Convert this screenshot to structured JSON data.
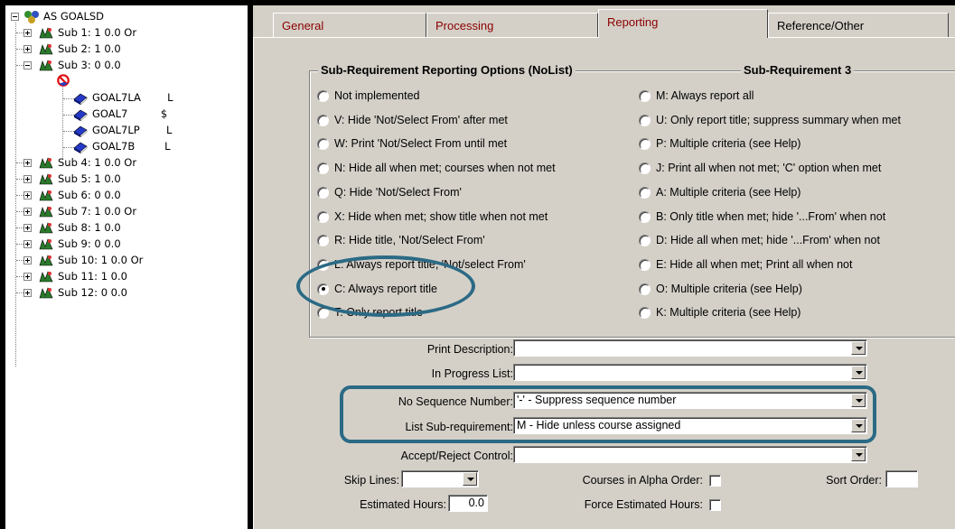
{
  "tree": {
    "root": {
      "label": "AS GOALSD"
    },
    "subs_top": [
      {
        "label": "Sub 1:  1     0.0  Or"
      },
      {
        "label": "Sub 2:  1     0.0"
      },
      {
        "label": "Sub 3:  0     0.0"
      }
    ],
    "sub3_children": [
      {
        "label": "",
        "icon": "no-sign-icon"
      },
      {
        "label": "GOAL7LA        L"
      },
      {
        "label": "GOAL7          $"
      },
      {
        "label": "GOAL7LP        L"
      },
      {
        "label": "GOAL7B         L"
      }
    ],
    "subs_bottom": [
      {
        "label": "Sub 4:  1     0.0  Or"
      },
      {
        "label": "Sub 5:  1     0.0"
      },
      {
        "label": "Sub 6:  0     0.0"
      },
      {
        "label": "Sub 7:  1     0.0  Or"
      },
      {
        "label": "Sub 8:  1     0.0"
      },
      {
        "label": "Sub 9:  0     0.0"
      },
      {
        "label": "Sub 10:  1     0.0  Or"
      },
      {
        "label": "Sub 11:  1     0.0"
      },
      {
        "label": "Sub 12:  0     0.0"
      }
    ]
  },
  "tabs": [
    {
      "label": "General",
      "active": false
    },
    {
      "label": "Processing",
      "active": false
    },
    {
      "label": "Reporting",
      "active": true
    },
    {
      "label": "Reference/Other",
      "active": false
    }
  ],
  "reporting": {
    "group_title": "Sub-Requirement Reporting Options (NoList)",
    "sub_title": "Sub-Requirement 3",
    "left_options": [
      {
        "label": "Not implemented",
        "checked": false
      },
      {
        "label": "V: Hide 'Not/Select From' after met",
        "checked": false
      },
      {
        "label": "W: Print 'Not/Select From until met",
        "checked": false
      },
      {
        "label": "N: Hide all when met; courses when not met",
        "checked": false
      },
      {
        "label": "Q: Hide 'Not/Select From'",
        "checked": false
      },
      {
        "label": "X: Hide when met; show title when not met",
        "checked": false
      },
      {
        "label": "R: Hide title, 'Not/Select From'",
        "checked": false
      },
      {
        "label": "L: Always report title, 'Not/select From'",
        "checked": false
      },
      {
        "label": "C: Always report title",
        "checked": true
      },
      {
        "label": "T: Only report title",
        "checked": false
      }
    ],
    "right_options": [
      {
        "label": "M: Always report all",
        "checked": false
      },
      {
        "label": "U: Only report title; suppress summary when met",
        "checked": false
      },
      {
        "label": "P: Multiple criteria (see Help)",
        "checked": false
      },
      {
        "label": "J: Print all when not met; 'C' option when met",
        "checked": false
      },
      {
        "label": "A: Multiple criteria (see Help)",
        "checked": false
      },
      {
        "label": "B: Only title when met; hide '...From' when not",
        "checked": false
      },
      {
        "label": "D: Hide all when met; hide '...From' when not",
        "checked": false
      },
      {
        "label": "E: Hide all when met; Print all when not",
        "checked": false
      },
      {
        "label": "O: Multiple criteria (see Help)",
        "checked": false
      },
      {
        "label": "K: Multiple criteria (see Help)",
        "checked": false
      }
    ]
  },
  "fields": {
    "print_description": {
      "label": "Print Description:",
      "value": ""
    },
    "in_progress_list": {
      "label": "In Progress List:",
      "value": ""
    },
    "no_sequence_number": {
      "label": "No Sequence Number:",
      "value": "'-' - Suppress sequence number"
    },
    "list_sub_requirement": {
      "label": "List Sub-requirement:",
      "value": "M - Hide unless course assigned"
    },
    "accept_reject_control": {
      "label": "Accept/Reject Control:",
      "value": ""
    },
    "skip_lines": {
      "label": "Skip Lines:",
      "value": ""
    },
    "courses_in_alpha_order": {
      "label": "Courses in Alpha Order:",
      "checked": false
    },
    "sort_order": {
      "label": "Sort Order:",
      "value": ""
    },
    "estimated_hours": {
      "label": "Estimated Hours:",
      "value": "0.0"
    },
    "force_estimated_hours": {
      "label": "Force Estimated Hours:",
      "checked": false
    }
  },
  "colors": {
    "annotation": "#2b6a85",
    "tab_text": "#8b0000",
    "panel": "#d4d0c8"
  }
}
